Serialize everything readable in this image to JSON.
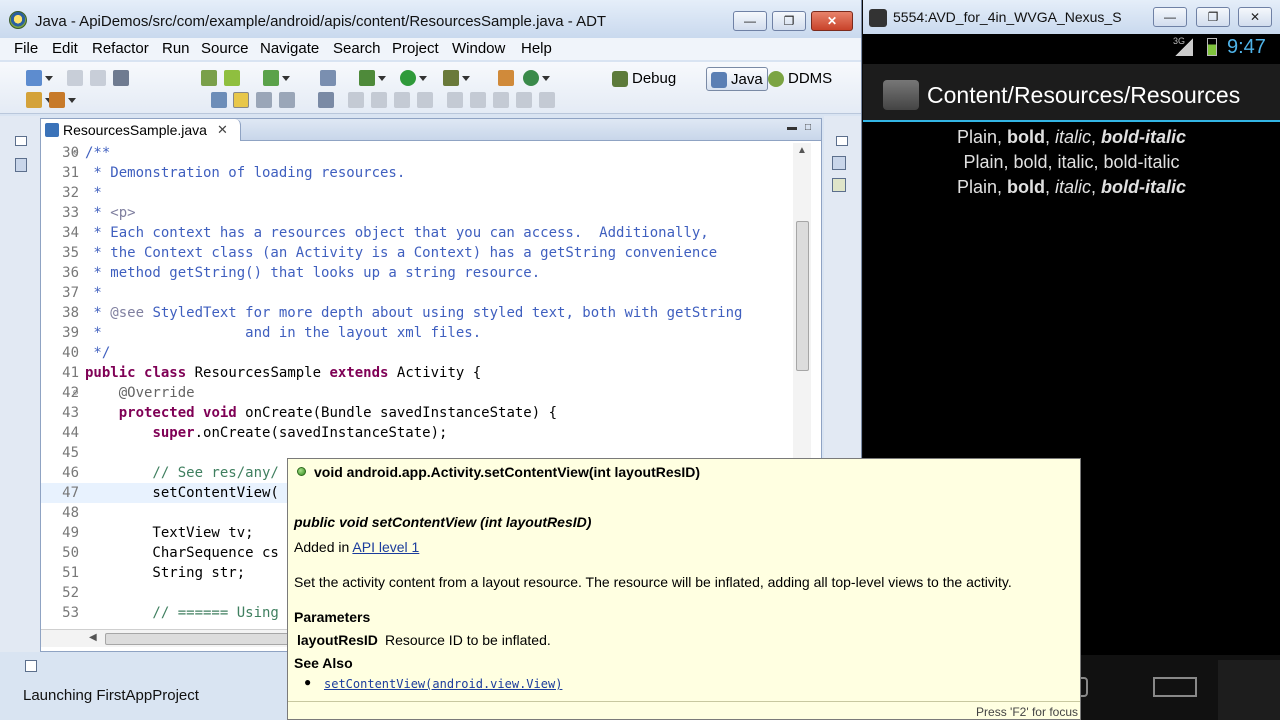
{
  "eclipse": {
    "title": "Java - ApiDemos/src/com/example/android/apis/content/ResourcesSample.java - ADT",
    "window_buttons": {
      "minimize": "—",
      "maximize": "❐",
      "close": "✕"
    },
    "menu": [
      "File",
      "Edit",
      "Refactor",
      "Run",
      "Source",
      "Navigate",
      "Search",
      "Project",
      "Window",
      "Help"
    ],
    "perspectives": [
      {
        "label": "Debug",
        "icon": "debug-icon"
      },
      {
        "label": "Java",
        "icon": "java-perspective-icon",
        "active": true
      },
      {
        "label": "DDMS",
        "icon": "ddms-icon"
      }
    ],
    "editor_tab": {
      "label": "ResourcesSample.java",
      "close": "✕"
    },
    "status": "Launching FirstAppProject"
  },
  "code_lines": [
    {
      "n": "30",
      "fold": "⊖",
      "parts": [
        {
          "t": "/**",
          "c": "cm"
        }
      ]
    },
    {
      "n": "31",
      "parts": [
        {
          "t": " * Demonstration of loading resources.",
          "c": "cm"
        }
      ]
    },
    {
      "n": "32",
      "parts": [
        {
          "t": " *",
          "c": "cm"
        }
      ]
    },
    {
      "n": "33",
      "parts": [
        {
          "t": " * ",
          "c": "cm"
        },
        {
          "t": "<p>",
          "c": "tg"
        }
      ]
    },
    {
      "n": "34",
      "parts": [
        {
          "t": " * Each context has a resources object that you can access.  Additionally,",
          "c": "cm"
        }
      ]
    },
    {
      "n": "35",
      "parts": [
        {
          "t": " * the Context class (an Activity is a Context) has a getString convenience",
          "c": "cm"
        }
      ]
    },
    {
      "n": "36",
      "parts": [
        {
          "t": " * method getString() that looks up a string resource.",
          "c": "cm"
        }
      ]
    },
    {
      "n": "37",
      "parts": [
        {
          "t": " *",
          "c": "cm"
        }
      ]
    },
    {
      "n": "38",
      "parts": [
        {
          "t": " * ",
          "c": "cm"
        },
        {
          "t": "@see",
          "c": "tg"
        },
        {
          "t": " StyledText for more depth about using styled text, both with getString",
          "c": "cm"
        }
      ]
    },
    {
      "n": "39",
      "parts": [
        {
          "t": " *                 and in the layout xml files.",
          "c": "cm"
        }
      ]
    },
    {
      "n": "40",
      "parts": [
        {
          "t": " */",
          "c": "cm"
        }
      ]
    },
    {
      "n": "41",
      "parts": [
        {
          "t": "public",
          "c": "kw"
        },
        {
          "t": " "
        },
        {
          "t": "class",
          "c": "kw"
        },
        {
          "t": " ResourcesSample "
        },
        {
          "t": "extends",
          "c": "kw"
        },
        {
          "t": " Activity {"
        }
      ]
    },
    {
      "n": "42",
      "fold": "⊖",
      "parts": [
        {
          "t": "    @Override",
          "c": "an"
        }
      ]
    },
    {
      "n": "43",
      "parts": [
        {
          "t": "    "
        },
        {
          "t": "protected",
          "c": "kw"
        },
        {
          "t": " "
        },
        {
          "t": "void",
          "c": "kw"
        },
        {
          "t": " onCreate(Bundle savedInstanceState) {"
        }
      ]
    },
    {
      "n": "44",
      "parts": [
        {
          "t": "        "
        },
        {
          "t": "super",
          "c": "kw"
        },
        {
          "t": ".onCreate(savedInstanceState);"
        }
      ]
    },
    {
      "n": "45",
      "parts": [
        {
          "t": ""
        }
      ]
    },
    {
      "n": "46",
      "parts": [
        {
          "t": "        // See res/any/",
          "c": "cm2"
        }
      ]
    },
    {
      "n": "47",
      "caret": true,
      "parts": [
        {
          "t": "        setContentView("
        }
      ]
    },
    {
      "n": "48",
      "parts": [
        {
          "t": ""
        }
      ]
    },
    {
      "n": "49",
      "parts": [
        {
          "t": "        TextView tv;"
        }
      ]
    },
    {
      "n": "50",
      "parts": [
        {
          "t": "        CharSequence cs"
        }
      ]
    },
    {
      "n": "51",
      "parts": [
        {
          "t": "        String str;"
        }
      ]
    },
    {
      "n": "52",
      "parts": [
        {
          "t": ""
        }
      ]
    },
    {
      "n": "53",
      "parts": [
        {
          "t": "        // ====== Using",
          "c": "cm2"
        }
      ]
    }
  ],
  "hover": {
    "title": "void android.app.Activity.setContentView(int layoutResID)",
    "signature": "public void setContentView (int layoutResID)",
    "added_prefix": "Added in ",
    "added_link": "API level 1",
    "description": "Set the activity content from a layout resource. The resource will be inflated, adding all top-level views to the activity.",
    "params_heading": "Parameters",
    "param_name": "layoutResID",
    "param_desc": "Resource ID to be inflated.",
    "see_also_heading": "See Also",
    "see_also_link": "setContentView(android.view.View)",
    "footer": "Press 'F2' for focus"
  },
  "emulator": {
    "title": "5554:AVD_for_4in_WVGA_Nexus_S",
    "network": "3G",
    "clock": "9:47",
    "activity_title": "Content/Resources/Resources",
    "lines": [
      [
        {
          "t": "Plain, "
        },
        {
          "t": "bold",
          "s": "b"
        },
        {
          "t": ", "
        },
        {
          "t": "italic",
          "s": "i"
        },
        {
          "t": ", "
        },
        {
          "t": "bold-italic",
          "s": "bi"
        }
      ],
      [
        {
          "t": "Plain, bold, italic, bold-italic"
        }
      ],
      [
        {
          "t": "Plain, "
        },
        {
          "t": "bold",
          "s": "b"
        },
        {
          "t": ", "
        },
        {
          "t": "italic",
          "s": "i"
        },
        {
          "t": ", "
        },
        {
          "t": "bold-italic",
          "s": "bi"
        }
      ]
    ]
  },
  "colors": {
    "comment": "#3f5fbf",
    "keyword": "#7f0055",
    "annotation": "#646464",
    "hover_bg": "#ffffe1",
    "android_accent": "#33b5e5"
  }
}
